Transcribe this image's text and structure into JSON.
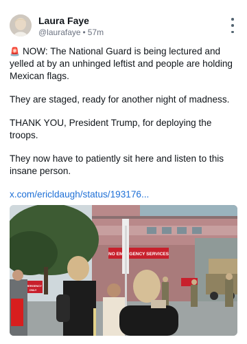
{
  "post": {
    "author_name": "Laura Faye",
    "author_handle": "@laurafaye",
    "meta_separator": "•",
    "age": "57m",
    "paragraphs": [
      "NOW: The National Guard is being lectured and yelled at by an unhinged leftist and people are holding Mexican flags.",
      "They are staged, ready for another night of madness.",
      "THANK YOU, President Trump, for deploying the troops.",
      "They now have to patiently sit here and listen to this insane person."
    ],
    "link_text": "x.com/ericldaugh/status/193176...",
    "icons": {
      "siren": "🚨",
      "more": "more-vertical-icon"
    }
  },
  "media": {
    "hospital_sign": "NO EMERGENCY SERVICES",
    "small_sign_left": "EMERGENCY",
    "small_sign_left2": "ONLY"
  },
  "colors": {
    "link": "#1d6fd6",
    "muted": "#6b7280",
    "sign_red": "#c8202c"
  }
}
